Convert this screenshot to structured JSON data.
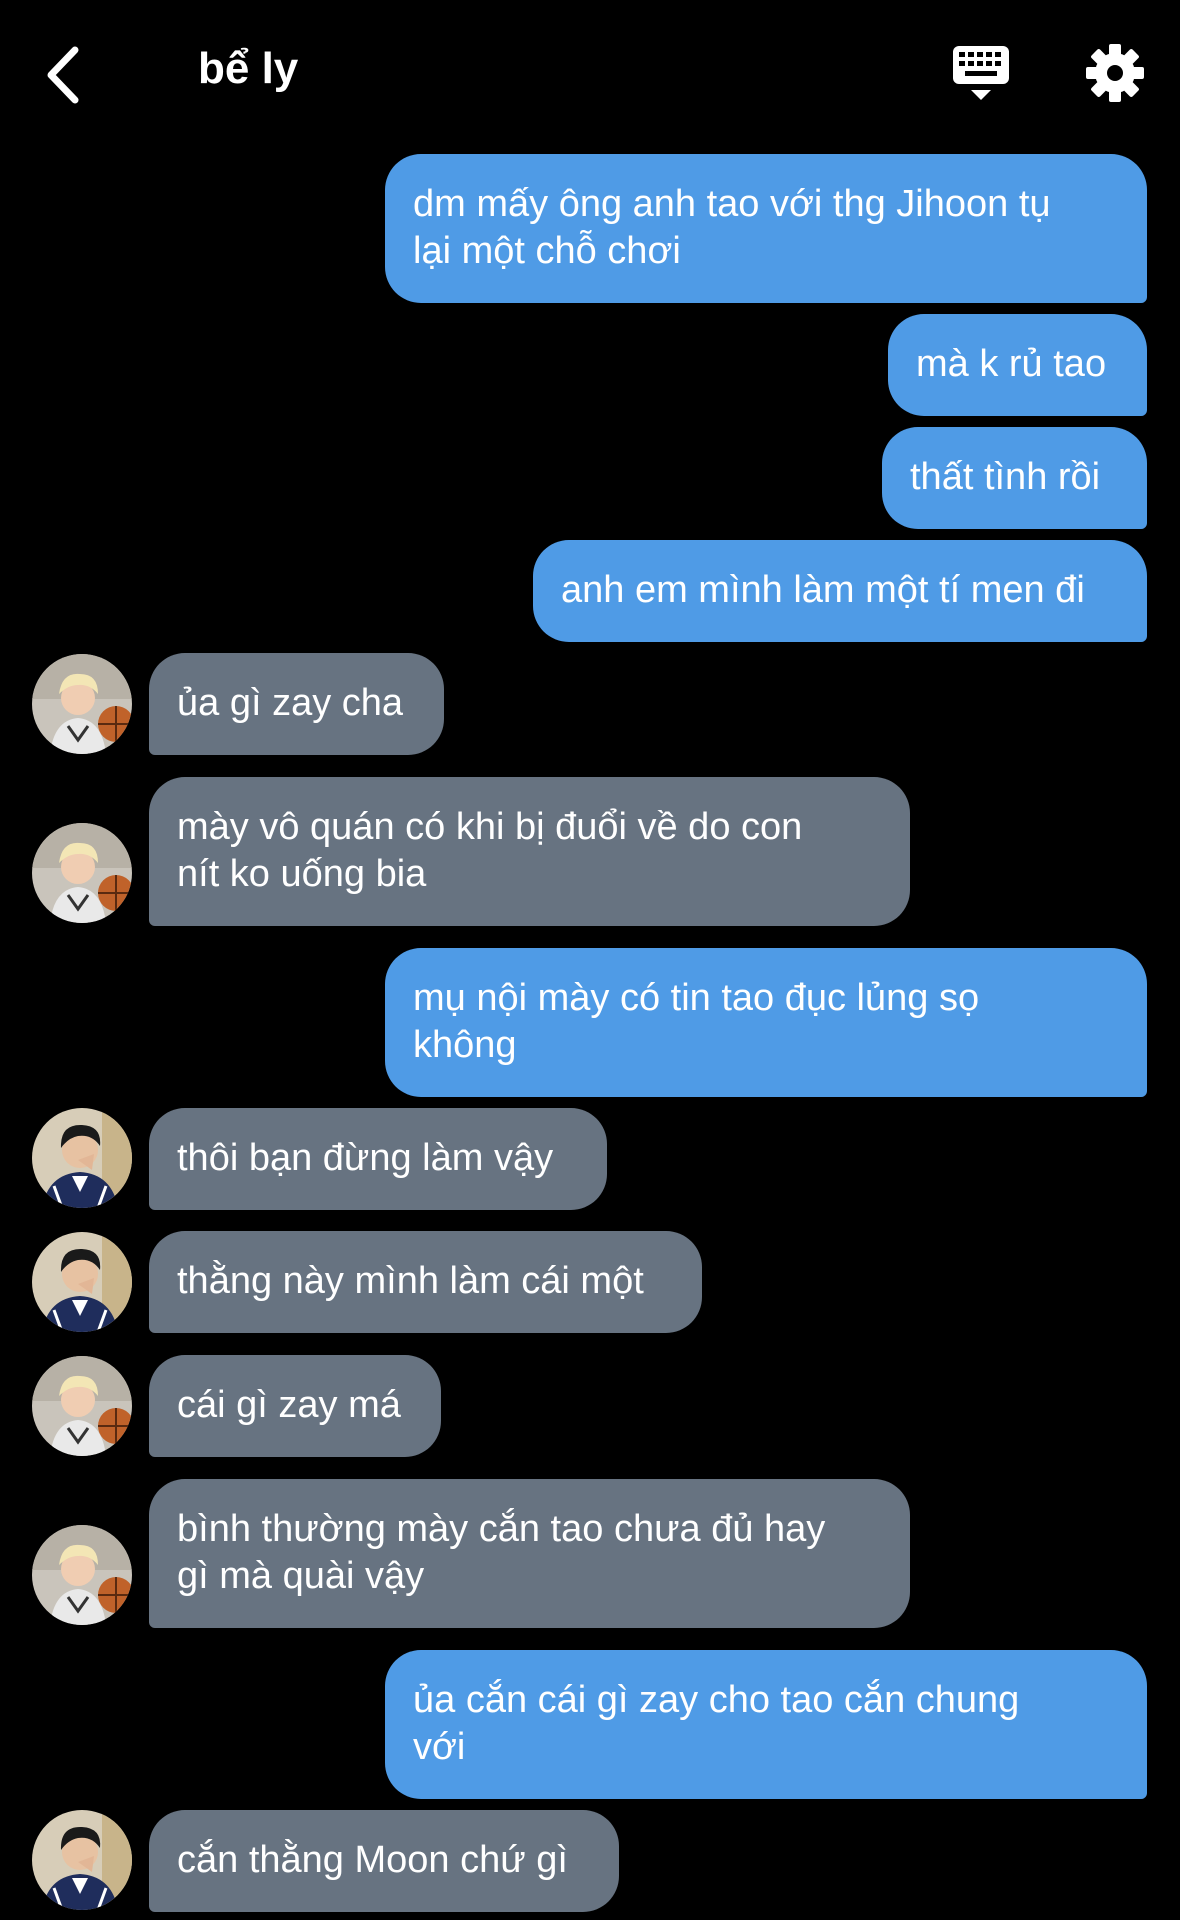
{
  "header": {
    "title": "bể ly",
    "back_icon": "chevron-left-icon",
    "keyboard_icon": "keyboard-icon",
    "settings_icon": "gear-icon"
  },
  "colors": {
    "background": "#000000",
    "sent_bubble": "#4f9be6",
    "received_bubble": "#677381"
  },
  "messages": [
    {
      "side": "sent",
      "text": "dm mấy ông anh tao với thg Jihoon tụ\nlại một chỗ chơi"
    },
    {
      "side": "sent",
      "text": "mà k rủ tao"
    },
    {
      "side": "sent",
      "text": "thất tình rồi"
    },
    {
      "side": "sent",
      "text": "anh em mình làm một tí men đi"
    },
    {
      "side": "received",
      "avatar": "blond-boy-basketball-avatar",
      "text": "ủa gì zay cha"
    },
    {
      "side": "received",
      "avatar": "blond-boy-basketball-avatar",
      "text": "mày vô quán có khi bị đuổi về do con\nnít ko uống bia"
    },
    {
      "side": "sent",
      "text": "mụ nội mày có tin tao đục lủng sọ\nkhông"
    },
    {
      "side": "received",
      "avatar": "dark-hair-boy-jacket-avatar",
      "text": "thôi bạn đừng làm vậy"
    },
    {
      "side": "received",
      "avatar": "dark-hair-boy-jacket-avatar",
      "text": "thằng này mình làm cái một"
    },
    {
      "side": "received",
      "avatar": "blond-boy-basketball-avatar",
      "text": "cái gì zay má"
    },
    {
      "side": "received",
      "avatar": "blond-boy-basketball-avatar",
      "text": "bình thường mày cắn tao chưa đủ hay\ngì mà quài vậy"
    },
    {
      "side": "sent",
      "text": "ủa cắn cái gì zay cho tao cắn chung\nvới"
    },
    {
      "side": "received",
      "avatar": "dark-hair-boy-jacket-avatar",
      "text": "cắn thằng Moon chứ gì"
    }
  ]
}
